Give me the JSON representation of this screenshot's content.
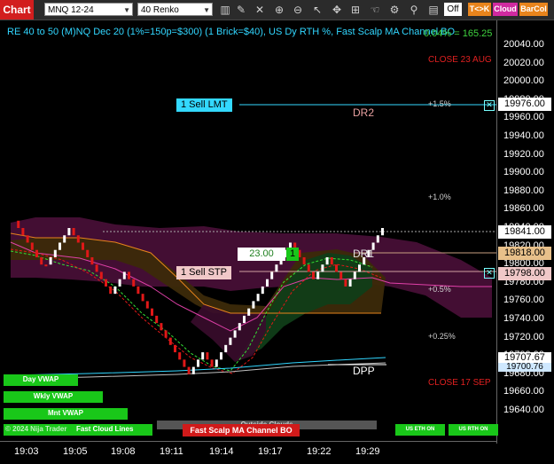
{
  "toolbar": {
    "chart_label": "Chart",
    "instrument": "MNQ 12-24",
    "bar_type": "40 Renko",
    "off_label": "Off",
    "tk_label": "T<>K",
    "cloud_label": "Cloud",
    "barcol_label": "BarCol",
    "colors": {
      "chart_bg": "#d21e1e",
      "tk": "#e8841c",
      "cloud": "#d02aa0",
      "barcol": "#e8841c"
    }
  },
  "chart": {
    "title": "RE 40 to 50 (M)NQ Dec 20 (1%=150p=$300) (1 Brick=$40), US Dy RTH %, Fast Scalp MA Channel BO",
    "top_value": "0.04% = 165.25",
    "close_23_aug": "CLOSE 23 AUG",
    "close_17_sep": "CLOSE 17 SEP",
    "dr2": "DR2",
    "dr1": "DR1",
    "dpp": "DPP",
    "pct_1_5": "+1.5%",
    "pct_1_0": "+1.0%",
    "pct_0_5": "+0.5%",
    "pct_0_25": "+0.25%",
    "sell_lmt": "1 Sell LMT",
    "sell_stp": "1 Sell STP",
    "qty_value": "23.00",
    "qty_count": "1",
    "day_vwap": "Day VWAP",
    "wkly_vwap": "Wkly VWAP",
    "mnt_vwap": "Mnt VWAP",
    "copyright": "© 2024 Nija Trader",
    "fast_cloud_lines": "Fast Cloud Lines",
    "outside_clouds": "Outside Clouds",
    "fast_scalp_btn": "Fast Scalp MA Channel BO",
    "us_eth_on": "US ETH ON",
    "us_rth_on": "US RTH ON",
    "y_ticks": [
      "20040.00",
      "20020.00",
      "20000.00",
      "19980.00",
      "19960.00",
      "19940.00",
      "19920.00",
      "19900.00",
      "19880.00",
      "19860.00",
      "19840.00",
      "19820.00",
      "19800.00",
      "19780.00",
      "19760.00",
      "19740.00",
      "19720.00",
      "19700.00",
      "19680.00",
      "19660.00",
      "19640.00"
    ],
    "x_ticks": [
      "19:03",
      "19:05",
      "19:08",
      "19:11",
      "19:14",
      "19:17",
      "19:22",
      "19:29"
    ],
    "price_labels": {
      "sell_lmt": "19976.00",
      "last": "19841.00",
      "dr1": "19818.00",
      "sell_stp": "19798.00",
      "vwap_a": "19707.67",
      "vwap_b": "19700.76"
    },
    "colors": {
      "up": "#ffffff",
      "down": "#e01818",
      "title": "#31d6ff",
      "cloud_top": "#5a1240",
      "cloud_mid": "#3d2d0a",
      "cloud_green": "#123d12"
    }
  },
  "chart_data": {
    "type": "candlestick",
    "bricks": [
      19848,
      19840,
      19832,
      19824,
      19816,
      19808,
      19800,
      19800,
      19808,
      19816,
      19824,
      19832,
      19840,
      19832,
      19824,
      19816,
      19808,
      19800,
      19792,
      19784,
      19776,
      19768,
      19776,
      19784,
      19792,
      19784,
      19776,
      19768,
      19760,
      19752,
      19744,
      19736,
      19728,
      19720,
      19712,
      19704,
      19696,
      19688,
      19680,
      19688,
      19696,
      19704,
      19696,
      19688,
      19696,
      19704,
      19712,
      19720,
      19728,
      19736,
      19744,
      19752,
      19760,
      19768,
      19776,
      19784,
      19792,
      19800,
      19808,
      19816,
      19824,
      19816,
      19808,
      19800,
      19792,
      19784,
      19792,
      19800,
      19808,
      19800,
      19792,
      19784,
      19776,
      19784,
      19792,
      19800,
      19808,
      19816,
      19824,
      19832,
      19840
    ],
    "ylim": [
      19630,
      20050
    ]
  }
}
